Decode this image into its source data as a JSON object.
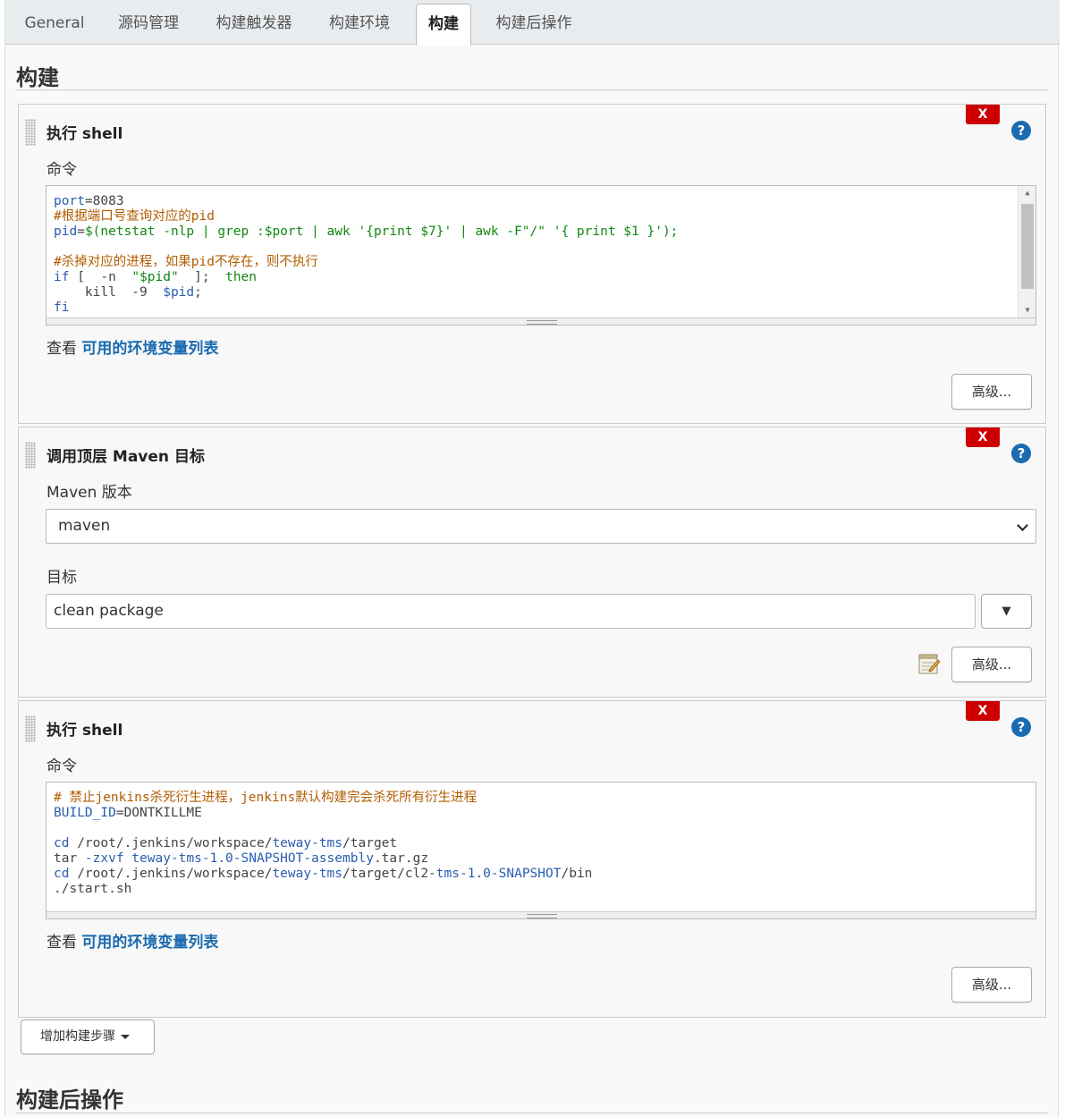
{
  "tabs": [
    {
      "label": "General"
    },
    {
      "label": "源码管理"
    },
    {
      "label": "构建触发器"
    },
    {
      "label": "构建环境"
    },
    {
      "label": "构建"
    },
    {
      "label": "构建后操作"
    }
  ],
  "active_tab": "构建",
  "build_section": {
    "title": "构建"
  },
  "post_build_section": {
    "title": "构建后操作"
  },
  "steps": [
    {
      "title": "执行 shell",
      "delete_label": "X",
      "help_label": "?",
      "command_label": "命令",
      "env_prefix": "查看",
      "env_link": "可用的环境变量列表",
      "advanced_label": "高级...",
      "code_lines": [
        "port=8083",
        "#根据端口号查询对应的pid",
        "pid=$(netstat -nlp | grep :$port | awk '{print $7}' | awk -F\"/\" '{ print $1 }');",
        "",
        "#杀掉对应的进程，如果pid不存在，则不执行",
        "if [  -n  \"$pid\"  ];  then",
        "    kill  -9  $pid;",
        "fi"
      ]
    },
    {
      "title": "调用顶层 Maven 目标",
      "delete_label": "X",
      "help_label": "?",
      "maven_version_label": "Maven 版本",
      "maven_version_value": "maven",
      "goals_label": "目标",
      "goals_value": "clean package",
      "advanced_label": "高级..."
    },
    {
      "title": "执行 shell",
      "delete_label": "X",
      "help_label": "?",
      "command_label": "命令",
      "env_prefix": "查看",
      "env_link": "可用的环境变量列表",
      "advanced_label": "高级...",
      "code_lines": [
        "# 禁止jenkins杀死衍生进程，jenkins默认构建完会杀死所有衍生进程",
        "BUILD_ID=DONTKILLME",
        "",
        "cd /root/.jenkins/workspace/teway-tms/target",
        "tar -zxvf teway-tms-1.0-SNAPSHOT-assembly.tar.gz",
        "cd /root/.jenkins/workspace/teway-tms/target/cl2-tms-1.0-SNAPSHOT/bin",
        "./start.sh"
      ]
    }
  ],
  "add_step_label": "增加构建步骤",
  "colors": {
    "delete": "#cc0000",
    "help": "#1a6bb0",
    "link": "#1a6bb0",
    "code_comment": "#b35c00",
    "code_keyword": "#2a5db0",
    "code_string": "#118811"
  },
  "icons": {
    "delete": "close-x-icon",
    "help": "help-question-icon",
    "grip": "drag-grip-icon",
    "notepad": "notepad-edit-icon",
    "dropdown": "chevron-down-icon"
  }
}
